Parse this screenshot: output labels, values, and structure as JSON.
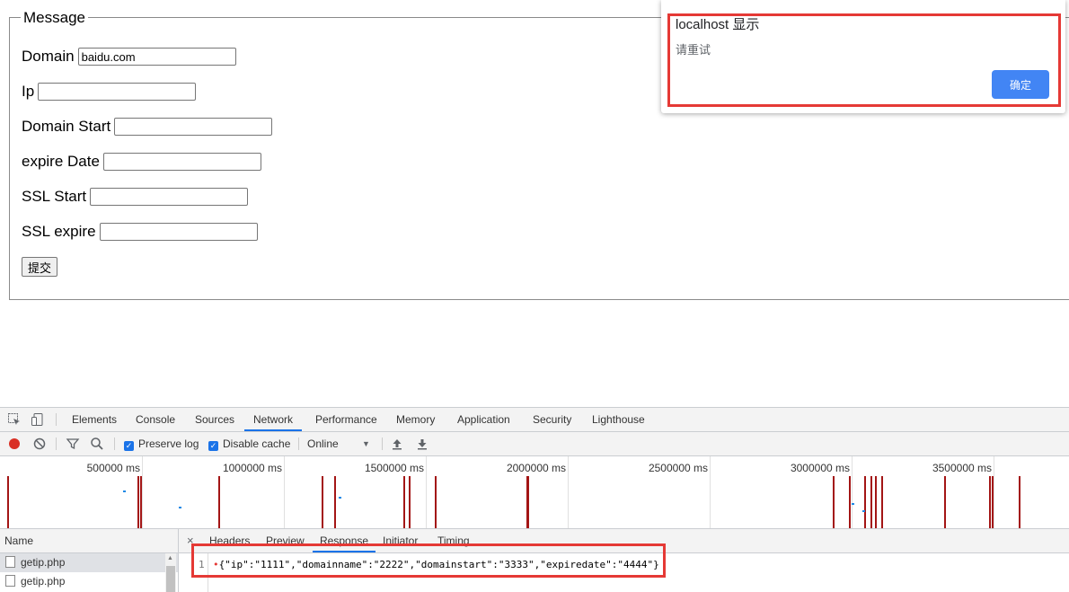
{
  "form": {
    "legend": "Message",
    "fields": [
      {
        "label": "Domain",
        "value": "baidu.com"
      },
      {
        "label": "Ip",
        "value": ""
      },
      {
        "label": "Domain Start",
        "value": ""
      },
      {
        "label": "expire Date",
        "value": ""
      },
      {
        "label": "SSL Start",
        "value": ""
      },
      {
        "label": "SSL expire",
        "value": ""
      }
    ],
    "submit_label": "提交"
  },
  "alert": {
    "title": "localhost 显示",
    "message": "请重试",
    "ok_label": "确定"
  },
  "devtools": {
    "tabs": [
      "Elements",
      "Console",
      "Sources",
      "Network",
      "Performance",
      "Memory",
      "Application",
      "Security",
      "Lighthouse"
    ],
    "active_tab": "Network",
    "toolbar": {
      "preserve_log": "Preserve log",
      "disable_cache": "Disable cache",
      "throttle": "Online"
    },
    "timeline_labels": [
      "500000 ms",
      "1000000 ms",
      "1500000 ms",
      "2000000 ms",
      "2500000 ms",
      "3000000 ms",
      "3500000 ms"
    ],
    "name_header": "Name",
    "files": [
      "getip.php",
      "getip.php"
    ],
    "detail_tabs": [
      "Headers",
      "Preview",
      "Response",
      "Initiator",
      "Timing"
    ],
    "active_detail_tab": "Response",
    "response": {
      "line_number": "1",
      "text": "{\"ip\":\"1111\",\"domainname\":\"2222\",\"domainstart\":\"3333\",\"expiredate\":\"4444\"}"
    },
    "accent_color": "#1a73e8",
    "highlight_color": "#e53935"
  }
}
